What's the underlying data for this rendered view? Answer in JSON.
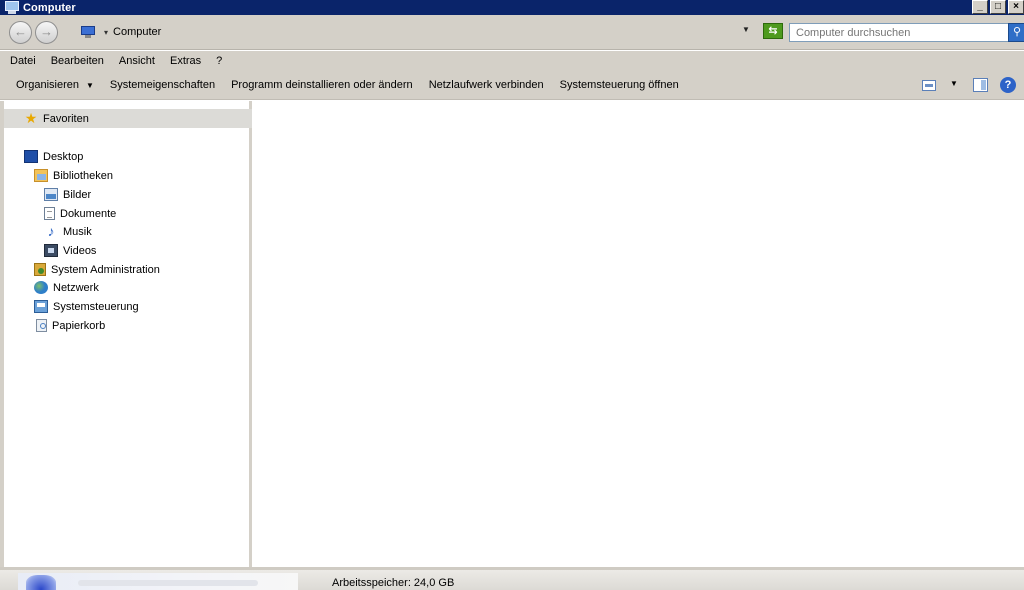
{
  "window": {
    "title": "Computer"
  },
  "address_bar": {
    "crumb": "Computer",
    "separator": "▾",
    "search_placeholder": "Computer durchsuchen"
  },
  "menu": {
    "items": [
      "Datei",
      "Bearbeiten",
      "Ansicht",
      "Extras",
      "?"
    ]
  },
  "commands": {
    "organize": "Organisieren",
    "system_properties": "Systemeigenschaften",
    "uninstall": "Programm deinstallieren oder ändern",
    "map_drive": "Netzlaufwerk verbinden",
    "control_panel": "Systemsteuerung öffnen"
  },
  "nav": {
    "favorites": "Favoriten",
    "desktop": "Desktop",
    "libraries": "Bibliotheken",
    "pictures": "Bilder",
    "documents": "Dokumente",
    "music": "Musik",
    "videos": "Videos",
    "system_admin": "System Administration",
    "network": "Netzwerk",
    "control_panel": "Systemsteuerung",
    "recycle_bin": "Papierkorb"
  },
  "details": {
    "memory": "Arbeitsspeicher: 24,0 GB"
  },
  "icons": {
    "titlebar": "computer-icon",
    "favorites": "star-icon",
    "desktop": "desktop-icon",
    "libraries": "library-icon",
    "pictures": "pictures-icon",
    "documents": "document-icon",
    "music": "music-note-icon",
    "videos": "video-icon",
    "system_admin": "admin-tools-icon",
    "network": "network-globe-icon",
    "control_panel": "control-panel-icon",
    "recycle_bin": "recycle-bin-icon"
  },
  "colors": {
    "titlebar": "#0a246a",
    "chrome": "#d4d0c8",
    "refresh": "#4e9a1e",
    "search_button": "#2f6ec7"
  }
}
